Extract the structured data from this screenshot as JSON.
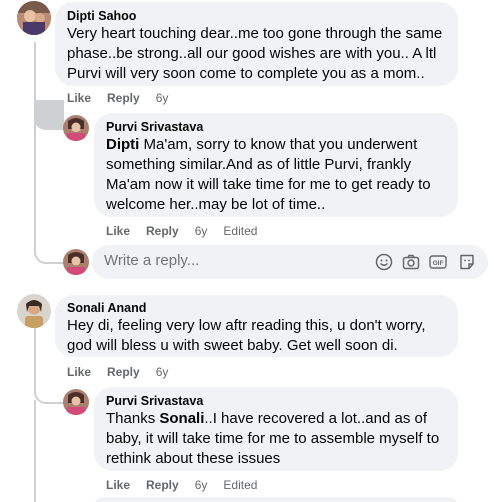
{
  "comments": [
    {
      "author": "Dipti Sahoo",
      "lines": [
        "Very heart touching dear..me too gone through the same",
        "phase..be strong..all our good wishes are with you.. A ltl",
        "Purvi will very soon come to complete you as a mom.."
      ],
      "actions": {
        "like": "Like",
        "reply": "Reply",
        "time": "6y"
      }
    },
    {
      "author": "Purvi Srivastava",
      "mention": "Dipti",
      "first_line_rest": " Ma'am, sorry to know that you underwent",
      "lines": [
        "something similar.And as of little Purvi, frankly",
        "Ma'am now it will take time for me to get ready to",
        "welcome her..may be lot of time.."
      ],
      "actions": {
        "like": "Like",
        "reply": "Reply",
        "time": "6y",
        "edited": "Edited"
      }
    },
    {
      "author": "Sonali Anand",
      "lines": [
        "Hey di, feeling very low aftr reading this, u don't worry,",
        "god will bless u with sweet baby. Get well soon di."
      ],
      "actions": {
        "like": "Like",
        "reply": "Reply",
        "time": "6y"
      }
    },
    {
      "author": "Purvi Srivastava",
      "first_line_pre": "Thanks ",
      "mention": "Sonali",
      "first_line_rest": "..I have recovered a lot..and as of",
      "lines": [
        "baby, it will take time for me to assemble myself to",
        "rethink about these issues"
      ],
      "actions": {
        "like": "Like",
        "reply": "Reply",
        "time": "6y",
        "edited": "Edited"
      }
    }
  ],
  "reply_box": {
    "placeholder": "Write a reply..."
  },
  "icons": [
    "emoji-icon",
    "camera-icon",
    "gif-icon",
    "sticker-icon"
  ]
}
